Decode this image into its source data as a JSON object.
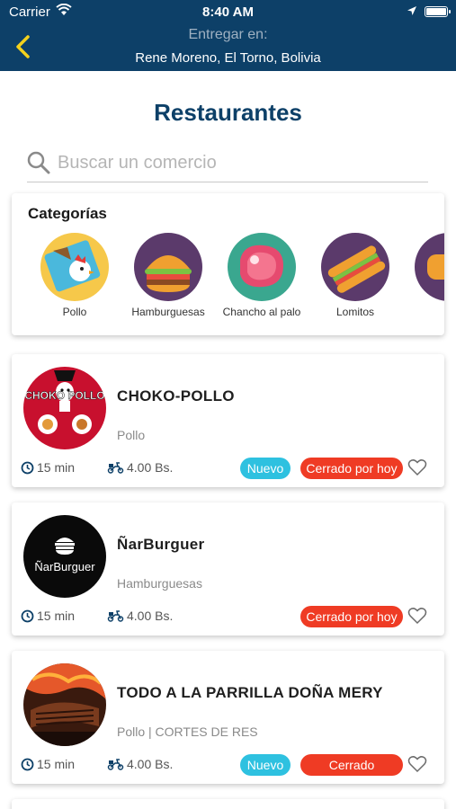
{
  "status_bar": {
    "carrier": "Carrier",
    "time": "8:40 AM"
  },
  "header": {
    "deliver_label": "Entregar en:",
    "address": "Rene Moreno, El Torno, Bolivia"
  },
  "page_title": "Restaurantes",
  "search": {
    "placeholder": "Buscar un comercio"
  },
  "categories": {
    "title": "Categorías",
    "items": [
      {
        "label": "Pollo",
        "icon": "chicken-icon"
      },
      {
        "label": "Hamburguesas",
        "icon": "burger-icon"
      },
      {
        "label": "Chancho al palo",
        "icon": "meat-icon"
      },
      {
        "label": "Lomitos",
        "icon": "sandwich-icon"
      }
    ]
  },
  "restaurants": [
    {
      "name": "CHOKO-POLLO",
      "categories": "Pollo",
      "logo_text": "CHOKO POLLO",
      "time": "15 min",
      "fee": "4.00 Bs.",
      "badge_new": "Nuevo",
      "badge_status": "Cerrado por hoy"
    },
    {
      "name": "ÑarBurguer",
      "categories": "Hamburguesas",
      "logo_text": "ÑarBurguer",
      "time": "15 min",
      "fee": "4.00 Bs.",
      "badge_status": "Cerrado por hoy"
    },
    {
      "name": "TODO A LA PARRILLA DOÑA MERY",
      "categories": "Pollo | CORTES DE RES",
      "time": "15 min",
      "fee": "4.00 Bs.",
      "badge_new": "Nuevo",
      "badge_status": "Cerrado"
    }
  ],
  "colors": {
    "header": "#0d4068",
    "accent_new": "#2ec1e0",
    "accent_closed": "#ef3b24",
    "back_arrow": "#f4d21c"
  }
}
